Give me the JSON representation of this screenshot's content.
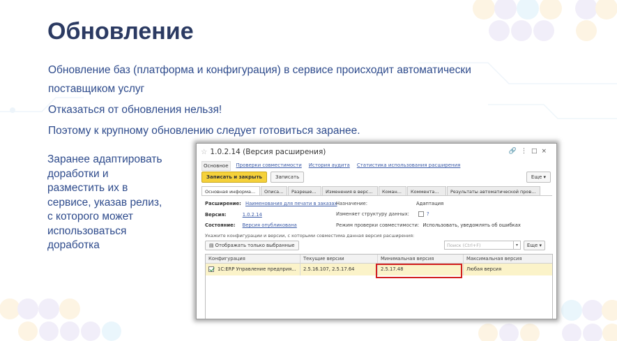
{
  "slide": {
    "title": "Обновление",
    "line1": "Обновление баз (платформа и конфигурация) в сервисе происходит автоматически",
    "line2": "поставщиком услуг",
    "line3": "Отказаться от обновления нельзя!",
    "line4": "Поэтому к крупному обновлению следует готовиться заранее.",
    "side": [
      "Заранее адаптировать",
      "доработки и",
      "разместить их в",
      "сервисе, указав релиз,",
      "с которого может",
      "использоваться",
      "доработка"
    ]
  },
  "window": {
    "title": "1.0.2.14 (Версия расширения)",
    "nav_tabs": [
      "Основное",
      "Проверки совместимости",
      "История аудита",
      "Статистика использования расширения"
    ],
    "toolbar": {
      "save_close": "Записать и закрыть",
      "save": "Записать",
      "more": "Еще"
    },
    "tabs": [
      "Основная информа...",
      "Описа...",
      "Разреше...",
      "Изменения в верс...",
      "Коман...",
      "Коммента...",
      "Результаты автоматической пров..."
    ],
    "fields": {
      "extension_label": "Расширение:",
      "extension_value": "Наименования для печати в заказах",
      "version_label": "Версия:",
      "version_value": "1.0.2.14",
      "state_label": "Состояние:",
      "state_value": "Версия опубликована",
      "purpose_label": "Назначение:",
      "purpose_value": "Адаптация",
      "changes_label": "Изменяет структуру данных:",
      "changes_value": "?",
      "mode_label": "Режим проверки совместимости:",
      "mode_value": "Использовать, уведомлять об ошибках"
    },
    "hint": "Укажите конфигурации и версии, с которыми совместима данная версия расширения:",
    "filter_button": "Отображать только выбранные",
    "search_placeholder": "Поиск (Ctrl+F)",
    "more2": "Еще",
    "grid": {
      "headers": [
        "Конфигурация",
        "Текущие версии",
        "Минимальная версия",
        "Максимальная версия"
      ],
      "row": [
        "1С:ERP Управление предприя...",
        "2.5.16.107, 2.5.17.64",
        "2.5.17.48",
        "Любая версия"
      ]
    }
  }
}
